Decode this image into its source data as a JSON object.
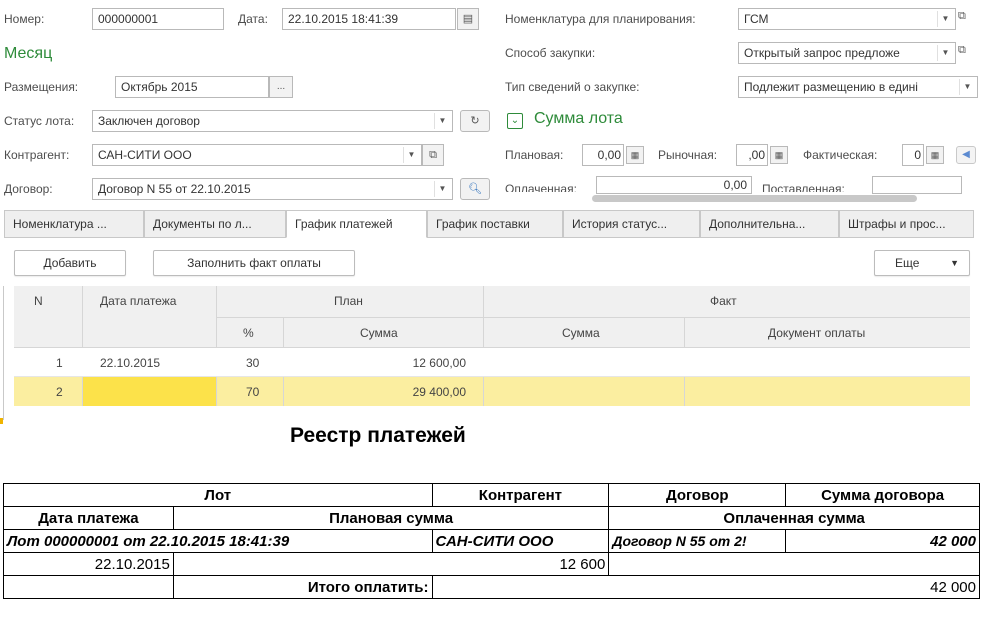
{
  "form": {
    "number_label": "Номер:",
    "number_value": "000000001",
    "date_label": "Дата:",
    "date_value": "22.10.2015 18:41:39",
    "month_header": "Месяц",
    "placement_label": "Размещения:",
    "placement_value": "Октябрь 2015",
    "placement_btn": "...",
    "lot_status_label": "Статус лота:",
    "lot_status_value": "Заключен договор",
    "counterparty_label": "Контрагент:",
    "counterparty_value": "САН-СИТИ ООО",
    "contract_label": "Договор:",
    "contract_value": "Договор N 55 от 22.10.2015",
    "nomenclature_label": "Номенклатура для планирования:",
    "nomenclature_value": "ГСМ",
    "purchase_method_label": "Способ закупки:",
    "purchase_method_value": "Открытый запрос предложе",
    "info_type_label": "Тип сведений о закупке:",
    "info_type_value": "Подлежит размещению в едині",
    "lot_sum_header": "Сумма лота",
    "planned_label": "Плановая:",
    "planned_value": "0,00",
    "market_label": "Рыночная:",
    "market_value": ",00",
    "actual_label": "Фактическая:",
    "actual_value": "0",
    "paid_label": "Оплаченная:",
    "paid_value": "0,00",
    "delivered_label": "Поставленная:"
  },
  "tabs": [
    {
      "label": "Номенклатура ..."
    },
    {
      "label": "Документы по л..."
    },
    {
      "label": "График платежей"
    },
    {
      "label": "График поставки"
    },
    {
      "label": "История статус..."
    },
    {
      "label": "Дополнительна..."
    },
    {
      "label": "Штрафы и прос..."
    }
  ],
  "toolbar": {
    "add_label": "Добавить",
    "fill_label": "Заполнить факт оплаты",
    "more_label": "Еще"
  },
  "grid": {
    "headers": {
      "n": "N",
      "date": "Дата платежа",
      "plan": "План",
      "fact": "Факт",
      "pct": "%",
      "plan_sum": "Сумма",
      "fact_sum": "Сумма",
      "doc": "Документ оплаты"
    },
    "rows": [
      {
        "n": "1",
        "date": "22.10.2015",
        "pct": "30",
        "sum": "12 600,00"
      },
      {
        "n": "2",
        "date": "",
        "pct": "70",
        "sum": "29 400,00"
      }
    ]
  },
  "report": {
    "title": "Реестр платежей",
    "h_lot": "Лот",
    "h_counterparty": "Контрагент",
    "h_contract": "Договор",
    "h_contract_sum": "Сумма договора",
    "h_pay_date": "Дата платежа",
    "h_planned_sum": "Плановая сумма",
    "h_paid_sum": "Оплаченная сумма",
    "lot_text": "Лот 000000001 от 22.10.2015 18:41:39",
    "counterparty": "САН-СИТИ ООО",
    "contract": "Договор N 55 от 2!",
    "contract_sum": "42 000",
    "row_date": "22.10.2015",
    "row_planned": "12 600",
    "total_label": "Итого оплатить:",
    "total_value": "42 000"
  },
  "colors": {
    "accent_green": "#2e8b3a",
    "selected_row": "#fbeea0",
    "grid_header": "#f0f0f0"
  }
}
